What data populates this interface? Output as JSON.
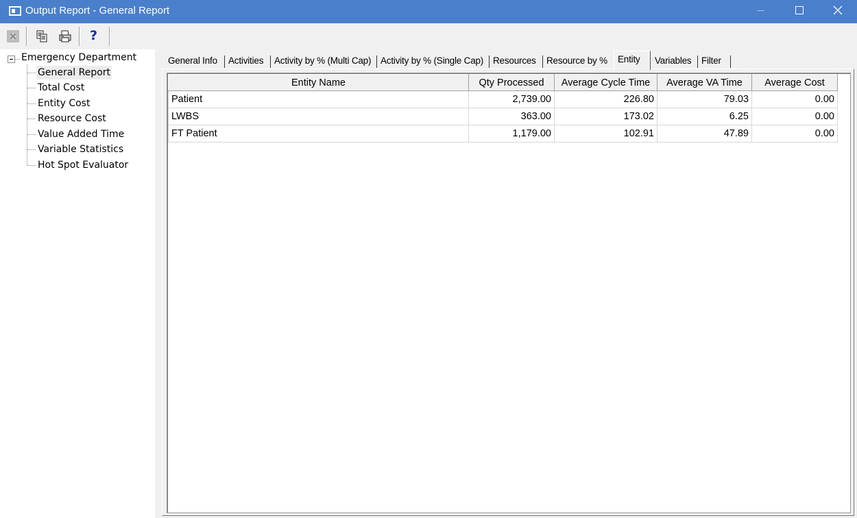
{
  "window": {
    "title": "Output Report - General Report",
    "accent_color": "#4a7fcc"
  },
  "toolbar": {
    "icons": [
      "close-report-icon",
      "copy-icon",
      "print-icon",
      "help-icon"
    ],
    "help_label": "?"
  },
  "tree": {
    "root": "Emergency Department",
    "items": [
      {
        "label": "General Report",
        "selected": true
      },
      {
        "label": "Total Cost"
      },
      {
        "label": "Entity Cost"
      },
      {
        "label": "Resource Cost"
      },
      {
        "label": "Value Added Time"
      },
      {
        "label": "Variable Statistics"
      },
      {
        "label": "Hot Spot Evaluator"
      }
    ]
  },
  "tabs": [
    {
      "label": "General Info"
    },
    {
      "label": "Activities"
    },
    {
      "label": "Activity by % (Multi Cap)"
    },
    {
      "label": "Activity by % (Single Cap)"
    },
    {
      "label": "Resources"
    },
    {
      "label": "Resource by %"
    },
    {
      "label": "Entity",
      "active": true
    },
    {
      "label": "Variables"
    },
    {
      "label": "Filter"
    }
  ],
  "table": {
    "headers": [
      "Entity Name",
      "Qty Processed",
      "Average Cycle Time",
      "Average VA Time",
      "Average Cost"
    ],
    "rows": [
      [
        "Patient",
        "2,739.00",
        "226.80",
        "79.03",
        "0.00"
      ],
      [
        "LWBS",
        "363.00",
        "173.02",
        "6.25",
        "0.00"
      ],
      [
        "FT Patient",
        "1,179.00",
        "102.91",
        "47.89",
        "0.00"
      ]
    ]
  }
}
